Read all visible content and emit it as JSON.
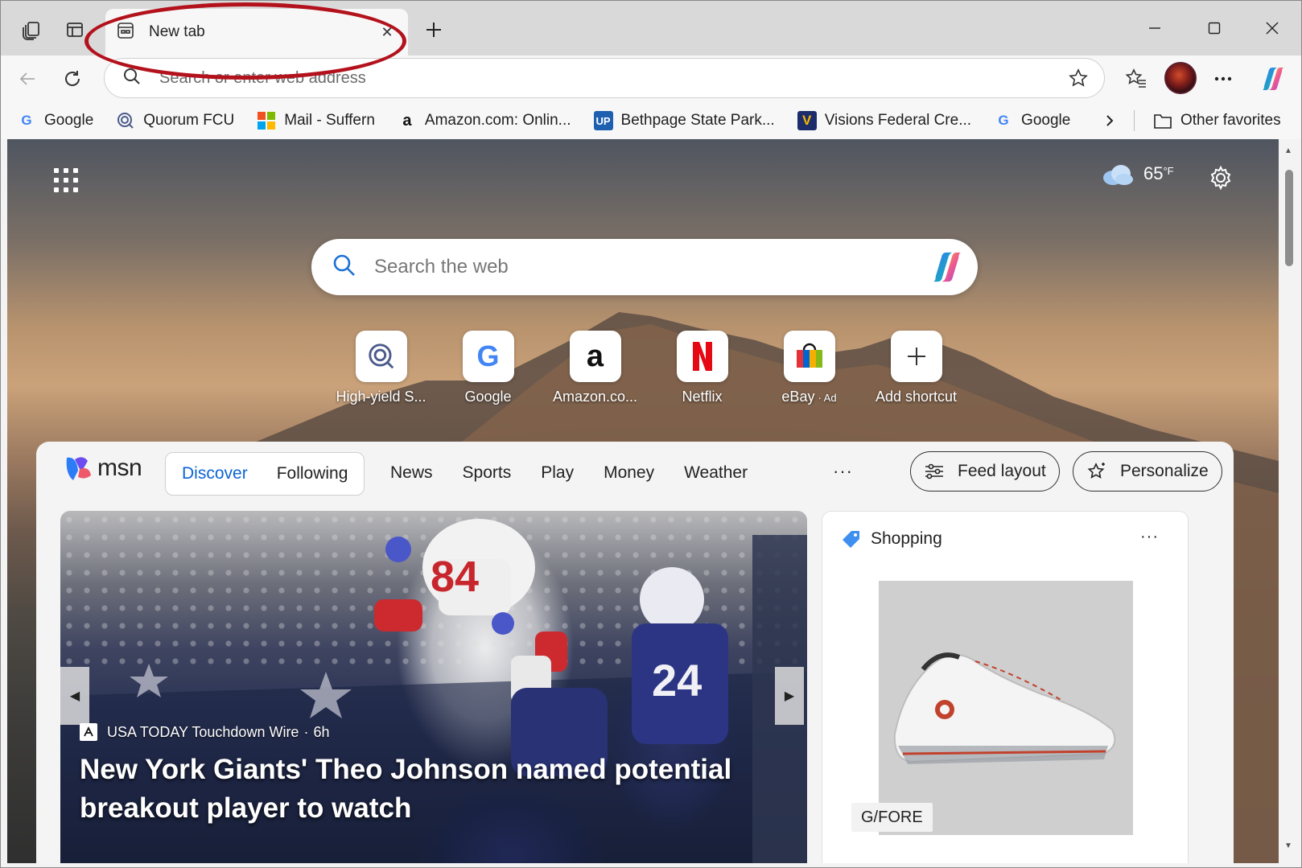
{
  "tabs": [
    {
      "title": "New tab",
      "close_glyph": "✕"
    }
  ],
  "tabstrip": {
    "new_tab_glyph": "+"
  },
  "window_controls": {
    "minimize": "—",
    "maximize": "☐",
    "close": "✕"
  },
  "toolbar": {
    "address_placeholder": "Search or enter web address"
  },
  "favorites": [
    {
      "label": "Google",
      "icon": "google-g"
    },
    {
      "label": "Quorum FCU",
      "icon": "quorum-q"
    },
    {
      "label": "Mail - Suffern",
      "icon": "microsoft-logo"
    },
    {
      "label": "Amazon.com: Onlin...",
      "icon": "amazon-a"
    },
    {
      "label": "Bethpage State Park...",
      "icon": "up-logo"
    },
    {
      "label": "Visions Federal Cre...",
      "icon": "visions-v"
    },
    {
      "label": "Google",
      "icon": "google-g"
    }
  ],
  "favorites_bar": {
    "other_favorites": "Other favorites"
  },
  "weather": {
    "temp": "65",
    "unit": "°F"
  },
  "search": {
    "placeholder": "Search the web"
  },
  "shortcuts": [
    {
      "label": "High-yield S...",
      "ad": ""
    },
    {
      "label": "Google",
      "ad": ""
    },
    {
      "label": "Amazon.co...",
      "ad": ""
    },
    {
      "label": "Netflix",
      "ad": ""
    },
    {
      "label": "eBay",
      "ad": "· Ad"
    },
    {
      "label": "Add shortcut",
      "ad": ""
    }
  ],
  "feed": {
    "logo_text": "msn",
    "segments": [
      "Discover",
      "Following"
    ],
    "nav": [
      "News",
      "Sports",
      "Play",
      "Money",
      "Weather"
    ],
    "more": "···",
    "feed_layout": "Feed layout",
    "personalize": "Personalize"
  },
  "hero": {
    "source": "USA TODAY Touchdown Wire",
    "age": "6h",
    "title": "New York Giants' Theo Johnson named potential breakout player to watch"
  },
  "shopping": {
    "title": "Shopping",
    "more": "···",
    "brand": "G/FORE"
  },
  "colors": {
    "accent": "#0c63d6",
    "highlight_ring": "#b3121c"
  }
}
